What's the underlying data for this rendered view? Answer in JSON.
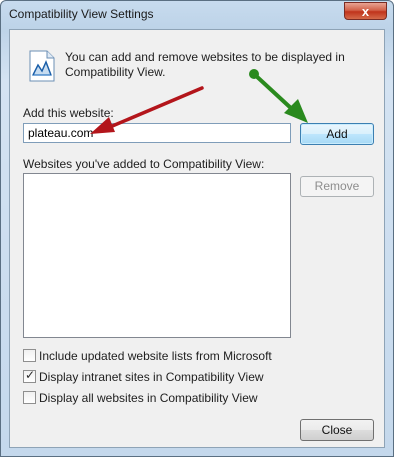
{
  "window": {
    "title": "Compatibility View Settings",
    "close_glyph": "x"
  },
  "intro": {
    "text": "You can add and remove websites to be displayed in Compatibility View.",
    "icon": "compatibility-view-icon"
  },
  "add_website": {
    "label": "Add this website:",
    "value": "plateau.com",
    "add_button": "Add"
  },
  "added_list": {
    "label": "Websites you've added to Compatibility View:",
    "items": [],
    "remove_button": "Remove"
  },
  "options": [
    {
      "label": "Include updated website lists from Microsoft",
      "checked": false
    },
    {
      "label": "Display intranet sites in Compatibility View",
      "checked": true
    },
    {
      "label": "Display all websites in Compatibility View",
      "checked": false
    }
  ],
  "footer": {
    "close_button": "Close"
  },
  "annotation_colors": {
    "red_arrow": "#b3151b",
    "green_arrow": "#2a8a1e"
  }
}
